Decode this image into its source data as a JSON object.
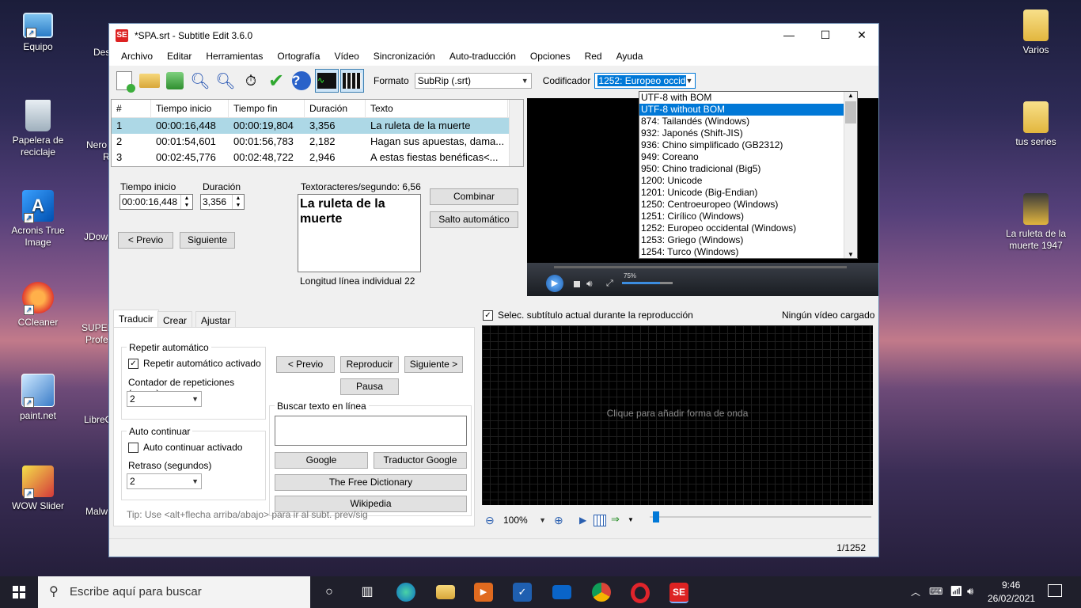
{
  "desktop": {
    "left_icons": [
      {
        "label": "Equipo",
        "icon": "computer-icon"
      },
      {
        "label": "Papelera de reciclaje",
        "icon": "recycle-bin-icon"
      },
      {
        "label": "Acronis True Image",
        "icon": "acronis-icon"
      },
      {
        "label": "CCleaner",
        "icon": "ccleaner-icon"
      },
      {
        "label": "paint.net",
        "icon": "paintnet-icon"
      },
      {
        "label": "WOW Slider",
        "icon": "wowslider-icon"
      }
    ],
    "second_col": [
      "Des",
      "Nero",
      "R",
      "JDown",
      "SUPER",
      "Profe",
      "LibreO",
      "Malw"
    ],
    "right_icons": [
      {
        "label": "Varios",
        "icon": "folder-icon"
      },
      {
        "label": "tus series",
        "icon": "folder-icon"
      },
      {
        "label": "La ruleta de la muerte 1947",
        "icon": "folder-icon"
      }
    ]
  },
  "window": {
    "title": "*SPA.srt - Subtitle Edit 3.6.0",
    "app_icon": "SE",
    "controls": {
      "minimize": "—",
      "maximize": "☐",
      "close": "✕"
    }
  },
  "menu": [
    "Archivo",
    "Editar",
    "Herramientas",
    "Ortografía",
    "Vídeo",
    "Sincronización",
    "Auto-traducción",
    "Opciones",
    "Red",
    "Ayuda"
  ],
  "toolbar": {
    "format_label": "Formato",
    "format_value": "SubRip (.srt)",
    "encoding_label": "Codificador",
    "encoding_value": "1252: Europeo occid"
  },
  "encoding_options": [
    "UTF-8 with BOM",
    "UTF-8 without BOM",
    "874: Tailandés (Windows)",
    "932: Japonés (Shift-JIS)",
    "936: Chino simplificado (GB2312)",
    "949: Coreano",
    "950: Chino tradicional (Big5)",
    "1200: Unicode",
    "1201: Unicode (Big-Endian)",
    "1250: Centroeuropeo (Windows)",
    "1251: Cirílico (Windows)",
    "1252: Europeo occidental (Windows)",
    "1253: Griego (Windows)",
    "1254: Turco (Windows)"
  ],
  "encoding_selected_index": 1,
  "grid": {
    "headers": [
      "#",
      "Tiempo inicio",
      "Tiempo fin",
      "Duración",
      "Texto"
    ],
    "rows": [
      [
        "1",
        "00:00:16,448",
        "00:00:19,804",
        "3,356",
        "La ruleta de la muerte"
      ],
      [
        "2",
        "00:01:54,601",
        "00:01:56,783",
        "2,182",
        "Hagan sus apuestas, dama..."
      ],
      [
        "3",
        "00:02:45,776",
        "00:02:48,722",
        "2,946",
        "A estas fiestas benéficas<..."
      ]
    ]
  },
  "editor": {
    "start_label": "Tiempo inicio",
    "start_value": "00:00:16,448",
    "duration_label": "Duración",
    "duration_value": "3,356",
    "text_label": "Texto",
    "cps_label": "racteres/segundo: 6,56",
    "text_line1": "La ruleta de la",
    "text_line2": "muerte",
    "line_length": "Longitud línea individual 22",
    "prev": "< Previo",
    "next": "Siguiente",
    "combine": "Combinar",
    "autobreak": "Salto automático"
  },
  "video": {
    "volume_pct": "75%"
  },
  "tabs": [
    "Traducir",
    "Crear",
    "Ajustar"
  ],
  "translate": {
    "repeat_group": "Repetir automático",
    "repeat_check": "Repetir automático activado",
    "repeat_count_label": "Contador de repeticiones (veces)",
    "repeat_count": "2",
    "auto_group": "Auto continuar",
    "auto_check": "Auto continuar activado",
    "delay_label": "Retraso (segundos)",
    "delay": "2",
    "prev": "< Previo",
    "play": "Reproducir",
    "next": "Siguiente >",
    "pause": "Pausa",
    "search_group": "Buscar texto en línea",
    "google": "Google",
    "google_translate": "Traductor Google",
    "free_dict": "The Free Dictionary",
    "wikipedia": "Wikipedia",
    "tip": "Tip: Use <alt+flecha arriba/abajo> para ir al subt. prev/sig"
  },
  "waveform": {
    "sync_check": "Selec. subtítulo actual durante la reproducción",
    "no_video": "Ningún vídeo cargado",
    "placeholder": "Clique para añadir forma de onda",
    "zoom": "100%"
  },
  "status": {
    "position": "1/1252"
  },
  "taskbar": {
    "search_placeholder": "Escribe aquí para buscar",
    "time": "9:46",
    "date": "26/02/2021"
  },
  "colors": {
    "selection": "#0078d7",
    "row_selected": "#add8e6",
    "app_red": "#d22222"
  }
}
